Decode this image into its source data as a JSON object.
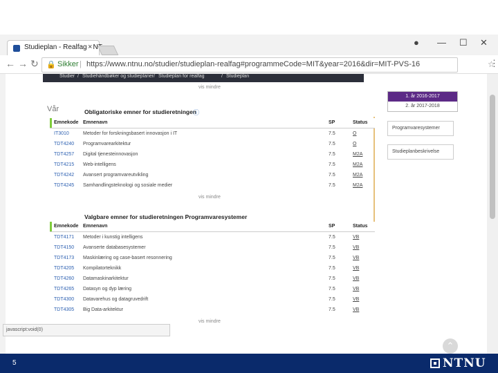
{
  "browser": {
    "tab_title": "Studieplan - Realfag - NT",
    "tab_close": "×",
    "window_controls": [
      "●",
      "—",
      "☐",
      "✕"
    ],
    "nav": [
      "←",
      "→",
      "↻"
    ],
    "secure_label": "Sikker",
    "url": "https://www.ntnu.no/studier/studieplan-realfag#programmeCode=MIT&year=2016&dir=MIT-PVS-16",
    "star": "☆",
    "menu": "⋮"
  },
  "breadcrumb": [
    "Studier",
    "/",
    "Studiehåndbøker og studieplaner",
    "/",
    "Studieplan for realfag",
    "/",
    "Studieplan"
  ],
  "sidebar": {
    "years": [
      "1. år 2016-2017",
      "2. år 2017-2018"
    ],
    "links": [
      "Programvaresystemer",
      "Studieplanbeskrivelse"
    ]
  },
  "vis_mindre": "vis mindre",
  "semester_label": "Vår",
  "mandatory": {
    "title": "Obligatoriske emner for studieretningen",
    "headers": {
      "code": "Emnekode",
      "name": "Emnenavn",
      "sp": "SP",
      "status": "Status"
    },
    "rows": [
      {
        "code": "IT3010",
        "name": "Metoder for forskningsbasert innovasjon i IT",
        "sp": "7.5",
        "status": "O"
      },
      {
        "code": "TDT4240",
        "name": "Programvarearkitektur",
        "sp": "7.5",
        "status": "O"
      },
      {
        "code": "TDT4257",
        "name": "Digital tjenesteinnovasjon",
        "sp": "7.5",
        "status": "M2A"
      },
      {
        "code": "TDT4215",
        "name": "Web-intelligens",
        "sp": "7.5",
        "status": "M2A"
      },
      {
        "code": "TDT4242",
        "name": "Avansert programvareutvikling",
        "sp": "7.5",
        "status": "M2A"
      },
      {
        "code": "TDT4245",
        "name": "Samhandlingsteknologi og sosiale medier",
        "sp": "7.5",
        "status": "M2A"
      }
    ]
  },
  "elective": {
    "title": "Valgbare emner for studieretningen Programvaresystemer",
    "headers": {
      "code": "Emnekode",
      "name": "Emnenavn",
      "sp": "SP",
      "status": "Status"
    },
    "rows": [
      {
        "code": "TDT4171",
        "name": "Metoder i kunstig intelligens",
        "sp": "7.5",
        "status": "VB"
      },
      {
        "code": "TDT4150",
        "name": "Avanserte databasesystemer",
        "sp": "7.5",
        "status": "VB"
      },
      {
        "code": "TDT4173",
        "name": "Maskinlæring og case-basert resonnering",
        "sp": "7.5",
        "status": "VB"
      },
      {
        "code": "TDT4205",
        "name": "Kompilatorteknikk",
        "sp": "7.5",
        "status": "VB"
      },
      {
        "code": "TDT4260",
        "name": "Datamaskinarkitektur",
        "sp": "7.5",
        "status": "VB"
      },
      {
        "code": "TDT4265",
        "name": "Datasyn og dyp læring",
        "sp": "7.5",
        "status": "VB"
      },
      {
        "code": "TDT4300",
        "name": "Datavarehus og datagruvedrift",
        "sp": "7.5",
        "status": "VB"
      },
      {
        "code": "TDT4305",
        "name": "Big Data-arkitektur",
        "sp": "7.5",
        "status": "VB"
      }
    ]
  },
  "status_bar": "javascript:void(0)",
  "slide_number": "5",
  "logo_text": "NTNU"
}
